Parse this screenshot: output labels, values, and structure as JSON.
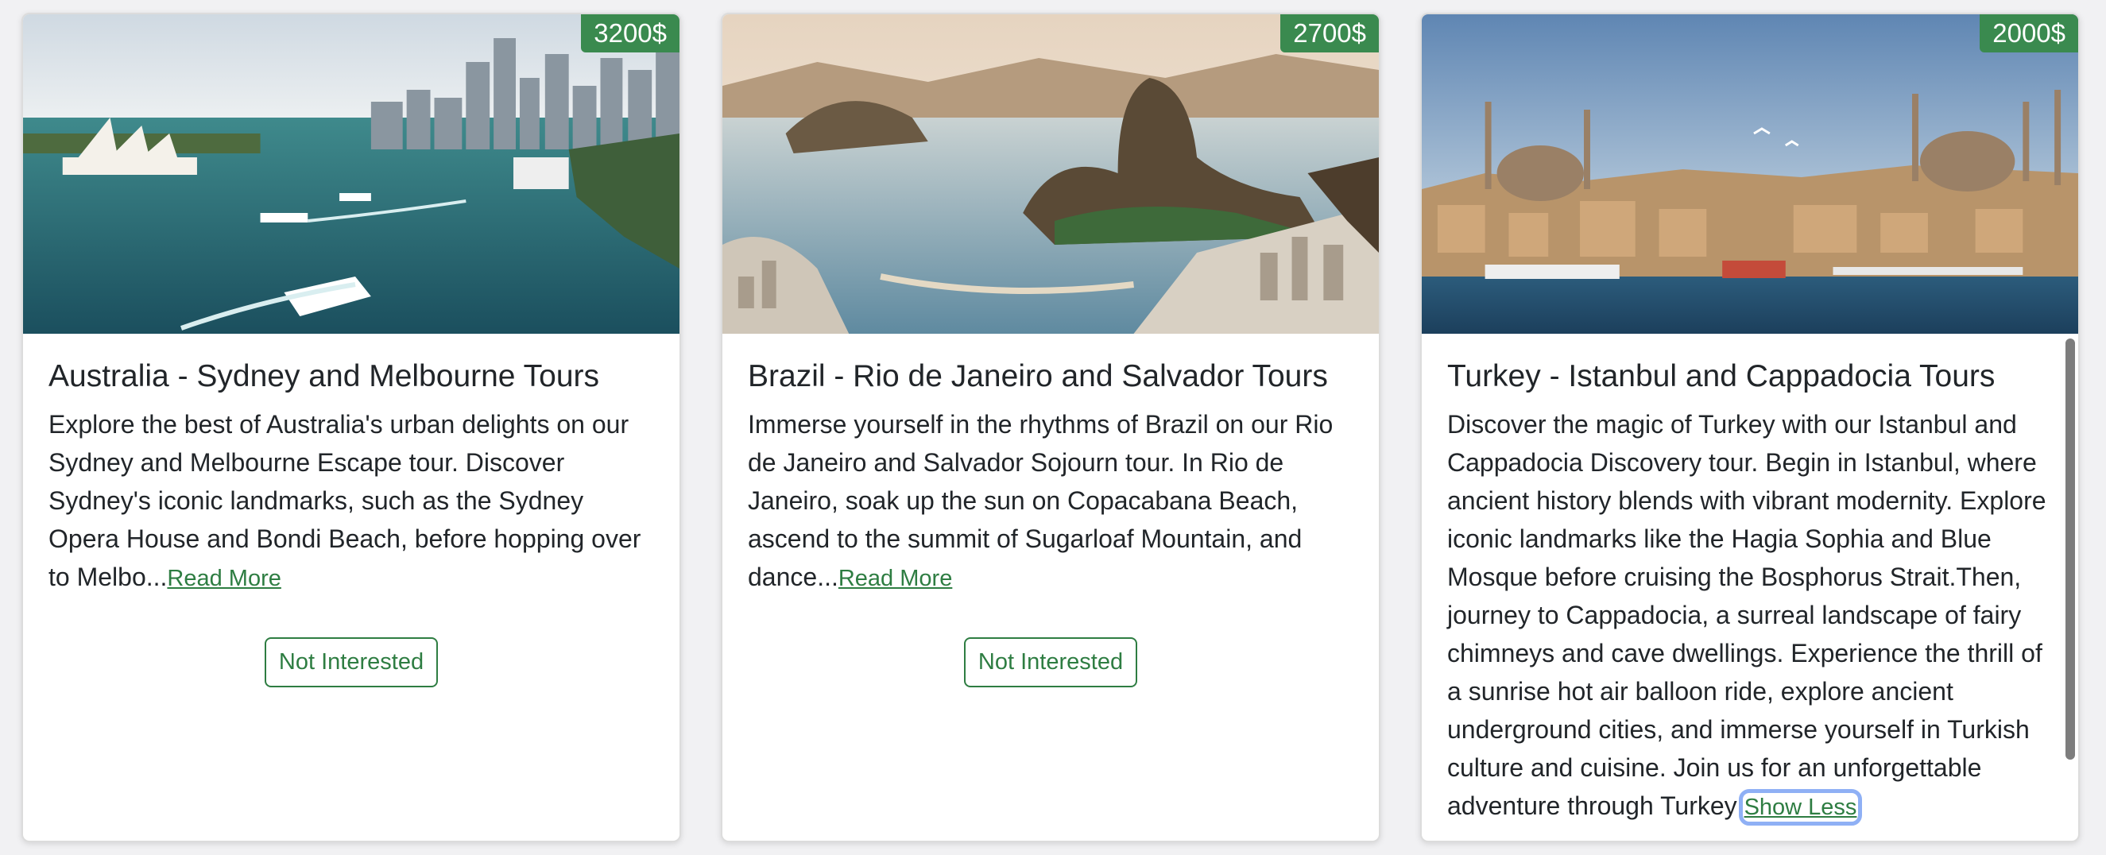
{
  "accent_color": "#3a8a4f",
  "cards": [
    {
      "price": "3200$",
      "title": "Australia - Sydney and Melbourne Tours",
      "description": "Explore the best of Australia's urban delights on our Sydney and Melbourne Escape tour. Discover Sydney's iconic landmarks, such as the Sydney Opera House and Bondi Beach, before hopping over to Melbo...",
      "toggle_label": "Read More",
      "button_label": "Not Interested",
      "image": "sydney-harbour-photo"
    },
    {
      "price": "2700$",
      "title": "Brazil - Rio de Janeiro and Salvador Tours",
      "description": "Immerse yourself in the rhythms of Brazil on our Rio de Janeiro and Salvador Sojourn tour. In Rio de Janeiro, soak up the sun on Copacabana Beach, ascend to the summit of Sugarloaf Mountain, and dance...",
      "toggle_label": "Read More",
      "button_label": "Not Interested",
      "image": "rio-sugarloaf-photo"
    },
    {
      "price": "2000$",
      "title": "Turkey - Istanbul and Cappadocia Tours",
      "description": "Discover the magic of Turkey with our Istanbul and Cappadocia Discovery tour. Begin in Istanbul, where ancient history blends with vibrant modernity. Explore iconic landmarks like the Hagia Sophia and Blue Mosque before cruising the Bosphorus Strait.Then, journey to Cappadocia, a surreal landscape of fairy chimneys and cave dwellings. Experience the thrill of a sunrise hot air balloon ride, explore ancient underground cities, and immerse yourself in Turkish culture and cuisine. Join us for an unforgettable adventure through Turkey!",
      "toggle_label": "Show Less",
      "image": "istanbul-skyline-photo"
    }
  ]
}
